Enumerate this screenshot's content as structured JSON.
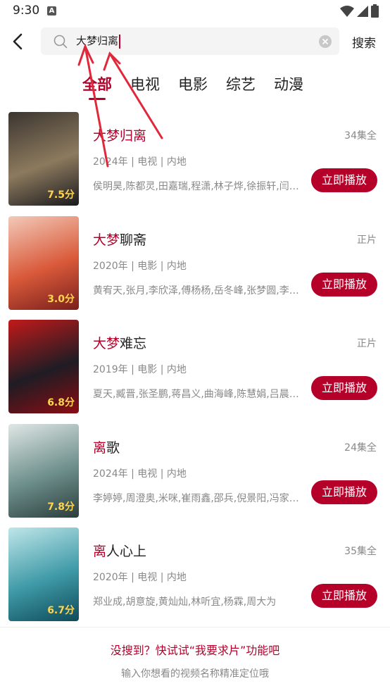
{
  "status_bar": {
    "time": "9:30",
    "notification_letter": "A"
  },
  "search": {
    "query": "大梦归离",
    "button_label": "搜索"
  },
  "tabs": [
    {
      "label": "全部",
      "active": true
    },
    {
      "label": "电视",
      "active": false
    },
    {
      "label": "电影",
      "active": false
    },
    {
      "label": "综艺",
      "active": false
    },
    {
      "label": "动漫",
      "active": false
    }
  ],
  "results": [
    {
      "title_hl": "大梦归离",
      "title_rest": "",
      "status": "34集全",
      "meta": "2024年 | 电视 | 内地",
      "cast": "侯明昊,陈都灵,田嘉瑞,程潇,林子烨,徐振轩,闫…",
      "score": "7.5分",
      "play_label": "立即播放",
      "poster_colors": [
        "#3b3530",
        "#8c7a5e",
        "#1b1a1e"
      ]
    },
    {
      "title_hl": "大梦",
      "title_rest": "聊斋",
      "status": "正片",
      "meta": "2020年 | 电影 | 内地",
      "cast": "黄宥天,张月,李欣泽,傅杨杨,岳冬峰,张梦圆,李…",
      "score": "3.0分",
      "play_label": "立即播放",
      "poster_colors": [
        "#f3c9b8",
        "#d95a3a",
        "#7a1f1c"
      ]
    },
    {
      "title_hl": "大梦",
      "title_rest": "难忘",
      "status": "正片",
      "meta": "2019年 | 电影 | 内地",
      "cast": "夏天,臧晋,张圣鹏,蒋昌义,曲海峰,陈慧娟,吕晨…",
      "score": "6.8分",
      "play_label": "立即播放",
      "poster_colors": [
        "#c21a1a",
        "#1f1c24",
        "#8a0d12"
      ]
    },
    {
      "title_hl": "离",
      "title_rest": "歌",
      "status": "24集全",
      "meta": "2024年 | 电视 | 内地",
      "cast": "李婷婷,周澄奥,米咪,崔雨鑫,邵兵,倪景阳,冯家…",
      "score": "7.8分",
      "play_label": "立即播放",
      "poster_colors": [
        "#dfe7e5",
        "#6e8f8c",
        "#2b3e3c"
      ]
    },
    {
      "title_hl": "离",
      "title_rest": "人心上",
      "status": "35集全",
      "meta": "2020年 | 电视 | 内地",
      "cast": "郑业成,胡意旋,黄灿灿,林听宜,杨霖,周大为",
      "score": "6.7分",
      "play_label": "立即播放",
      "poster_colors": [
        "#bfe6ea",
        "#3f9aa7",
        "#0f4a5a"
      ]
    }
  ],
  "footer": {
    "link_text": "没搜到？快试试“我要求片”功能吧",
    "hint_text": "输入你想看的视频名称精准定位哦"
  },
  "colors": {
    "accent": "#b5002a",
    "annotation_arrow": "#e0283a"
  }
}
